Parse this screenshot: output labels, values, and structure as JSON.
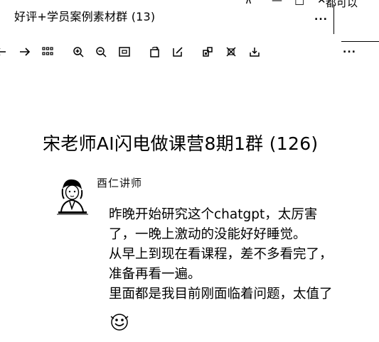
{
  "window": {
    "title": "好评+学员案例素材群 (13)",
    "controls": {
      "pin": "⊼",
      "minimize": "—",
      "maximize": "□",
      "close": "✕",
      "extra": "都可以"
    },
    "more_menu": "...",
    "more_menu_2": "..."
  },
  "toolbar": {
    "icons": [
      "back-arrow-icon",
      "forward-arrow-icon",
      "thumbnails-grid-icon",
      "zoom-in-icon",
      "zoom-out-icon",
      "fit-window-icon",
      "rotate-icon",
      "edit-icon",
      "qr-scan-icon",
      "crop-icon",
      "download-icon"
    ]
  },
  "chat": {
    "group_name": "宋老师AI闪电做课营8期1群 (126)",
    "sender": "酉仁讲师",
    "message_lines": [
      "昨晚开始研究这个chatgpt，太厉害",
      "了，一晚上激动的没能好好睡觉。",
      "从早上到现在看课程，差不多看完了，",
      "准备再看一遍。",
      "里面都是我目前刚面临着问题，太值了"
    ],
    "emoji": "smile-emoji-icon"
  }
}
